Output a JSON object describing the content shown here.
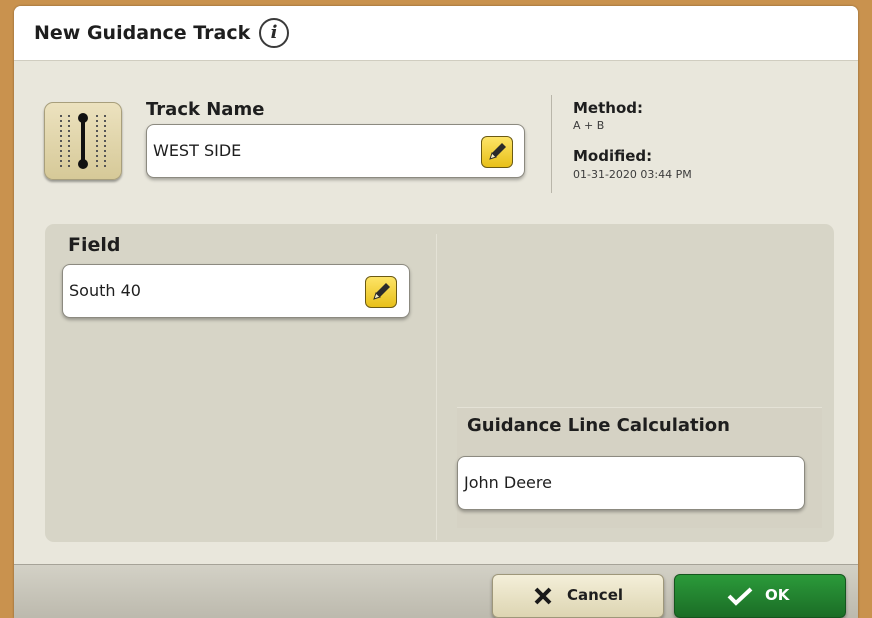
{
  "dialog": {
    "title": "New Guidance Track",
    "info_icon": "info-icon",
    "info_glyph": "i"
  },
  "track": {
    "icon": "guidance-track-icon",
    "name_label": "Track Name",
    "name_value": "WEST SIDE",
    "edit_icon": "pencil-icon"
  },
  "meta": {
    "method_label": "Method:",
    "method_value": "A + B",
    "modified_label": "Modified:",
    "modified_value": "01-31-2020 03:44 PM"
  },
  "field": {
    "label": "Field",
    "value": "South 40",
    "edit_icon": "pencil-icon"
  },
  "calculation": {
    "label": "Guidance Line Calculation",
    "value": "John Deere"
  },
  "footer": {
    "cancel_label": "Cancel",
    "cancel_icon": "x-icon",
    "ok_label": "OK",
    "ok_icon": "checkmark-icon"
  },
  "colors": {
    "ok_green": "#1f7a2c",
    "edit_yellow": "#f3d43b",
    "frame_orange": "#c9924e"
  }
}
